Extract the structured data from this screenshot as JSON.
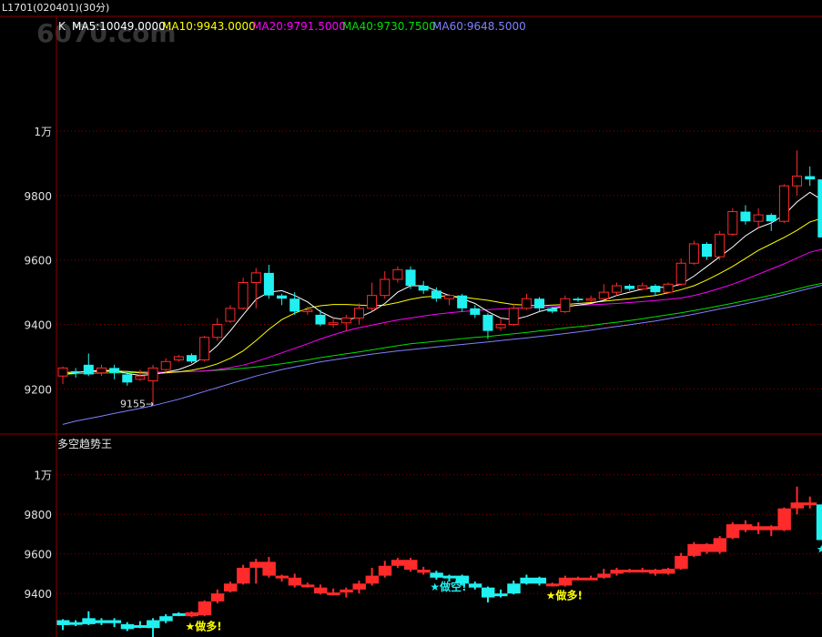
{
  "header": {
    "contract": "L1701(020401)(30分)",
    "watermark": "6070.com"
  },
  "colors": {
    "background": "#000000",
    "grid": "#8a0000",
    "axis_text": "#e0e0e0",
    "up": "#ff2a2a",
    "down": "#20f0f0",
    "ma5": "#ffffff",
    "ma10": "#ffff00",
    "ma20": "#ff00ff",
    "ma40": "#00e000",
    "ma60": "#8080ff"
  },
  "chart_data": [
    {
      "type": "candlestick",
      "legend": {
        "prefix": "K",
        "items": [
          {
            "label": "MA5:10049.0000",
            "color": "#ffffff"
          },
          {
            "label": "MA10:9943.0000",
            "color": "#ffff00"
          },
          {
            "label": "MA20:9791.5000",
            "color": "#ff00ff"
          },
          {
            "label": "MA40:9730.7500",
            "color": "#00e000"
          },
          {
            "label": "MA60:9648.5000",
            "color": "#8080ff"
          }
        ]
      },
      "ylim": [
        9060,
        10350
      ],
      "yticks": [
        {
          "value": 9200,
          "label": "9200"
        },
        {
          "value": 9400,
          "label": "9400"
        },
        {
          "value": 9600,
          "label": "9600"
        },
        {
          "value": 9800,
          "label": "9800"
        },
        {
          "value": 10000,
          "label": "1万"
        }
      ],
      "grid": true,
      "annotation": {
        "text": "9155",
        "value": 9155,
        "index": 7
      },
      "candles": [
        [
          9240,
          9265,
          9215,
          9270
        ],
        [
          9255,
          9250,
          9235,
          9265
        ],
        [
          9275,
          9245,
          9240,
          9310
        ],
        [
          9250,
          9265,
          9240,
          9275
        ],
        [
          9265,
          9250,
          9230,
          9275
        ],
        [
          9245,
          9220,
          9210,
          9255
        ],
        [
          9230,
          9240,
          9225,
          9260
        ],
        [
          9225,
          9265,
          9155,
          9275
        ],
        [
          9260,
          9285,
          9250,
          9295
        ],
        [
          9290,
          9300,
          9285,
          9305
        ],
        [
          9305,
          9285,
          9280,
          9310
        ],
        [
          9290,
          9360,
          9285,
          9365
        ],
        [
          9360,
          9400,
          9350,
          9420
        ],
        [
          9410,
          9450,
          9405,
          9460
        ],
        [
          9450,
          9530,
          9445,
          9545
        ],
        [
          9530,
          9560,
          9450,
          9575
        ],
        [
          9560,
          9490,
          9480,
          9585
        ],
        [
          9490,
          9480,
          9460,
          9495
        ],
        [
          9480,
          9440,
          9430,
          9500
        ],
        [
          9440,
          9445,
          9430,
          9455
        ],
        [
          9430,
          9400,
          9395,
          9445
        ],
        [
          9400,
          9405,
          9390,
          9425
        ],
        [
          9405,
          9420,
          9380,
          9430
        ],
        [
          9420,
          9450,
          9400,
          9465
        ],
        [
          9450,
          9490,
          9440,
          9530
        ],
        [
          9490,
          9540,
          9480,
          9565
        ],
        [
          9540,
          9570,
          9530,
          9580
        ],
        [
          9570,
          9520,
          9510,
          9580
        ],
        [
          9520,
          9505,
          9495,
          9535
        ],
        [
          9505,
          9480,
          9470,
          9515
        ],
        [
          9480,
          9490,
          9460,
          9495
        ],
        [
          9490,
          9450,
          9440,
          9495
        ],
        [
          9450,
          9430,
          9420,
          9460
        ],
        [
          9430,
          9380,
          9355,
          9435
        ],
        [
          9390,
          9400,
          9380,
          9420
        ],
        [
          9400,
          9450,
          9395,
          9465
        ],
        [
          9450,
          9480,
          9445,
          9495
        ],
        [
          9480,
          9450,
          9440,
          9485
        ],
        [
          9450,
          9440,
          9435,
          9455
        ],
        [
          9440,
          9480,
          9435,
          9490
        ],
        [
          9480,
          9475,
          9470,
          9485
        ],
        [
          9475,
          9480,
          9470,
          9490
        ],
        [
          9480,
          9500,
          9475,
          9525
        ],
        [
          9500,
          9520,
          9490,
          9530
        ],
        [
          9520,
          9510,
          9505,
          9525
        ],
        [
          9510,
          9520,
          9505,
          9530
        ],
        [
          9520,
          9500,
          9490,
          9525
        ],
        [
          9500,
          9525,
          9495,
          9530
        ],
        [
          9525,
          9590,
          9520,
          9605
        ],
        [
          9590,
          9650,
          9585,
          9660
        ],
        [
          9650,
          9610,
          9600,
          9655
        ],
        [
          9610,
          9680,
          9600,
          9690
        ],
        [
          9680,
          9750,
          9675,
          9760
        ],
        [
          9750,
          9720,
          9710,
          9770
        ],
        [
          9720,
          9740,
          9700,
          9760
        ],
        [
          9740,
          9720,
          9690,
          9745
        ],
        [
          9720,
          9830,
          9715,
          9835
        ],
        [
          9830,
          9860,
          9800,
          9940
        ],
        [
          9860,
          9850,
          9830,
          9890
        ],
        [
          9850,
          9670,
          9660,
          9860
        ],
        [
          9670,
          9650,
          9580,
          9680
        ],
        [
          9650,
          9700,
          9620,
          9730
        ]
      ],
      "ma": {
        "ma5": [
          9245,
          9250,
          9255,
          9258,
          9257,
          9248,
          9242,
          9245,
          9252,
          9260,
          9275,
          9300,
          9335,
          9380,
          9430,
          9478,
          9500,
          9505,
          9490,
          9470,
          9440,
          9420,
          9415,
          9422,
          9440,
          9465,
          9500,
          9520,
          9520,
          9505,
          9490,
          9480,
          9465,
          9440,
          9420,
          9415,
          9425,
          9440,
          9450,
          9455,
          9460,
          9465,
          9475,
          9490,
          9500,
          9510,
          9515,
          9515,
          9525,
          9550,
          9580,
          9610,
          9640,
          9675,
          9700,
          9715,
          9740,
          9780,
          9810,
          9785,
          9760,
          9720
        ],
        "ma10": [
          9250,
          9252,
          9254,
          9255,
          9256,
          9254,
          9250,
          9248,
          9250,
          9253,
          9258,
          9266,
          9278,
          9295,
          9318,
          9350,
          9385,
          9415,
          9435,
          9450,
          9458,
          9462,
          9462,
          9460,
          9458,
          9460,
          9468,
          9478,
          9485,
          9488,
          9488,
          9485,
          9480,
          9475,
          9468,
          9462,
          9460,
          9458,
          9460,
          9462,
          9465,
          9468,
          9472,
          9476,
          9480,
          9485,
          9490,
          9498,
          9508,
          9520,
          9538,
          9558,
          9580,
          9605,
          9630,
          9650,
          9670,
          9692,
          9718,
          9730,
          9738,
          9740
        ],
        "ma20": [
          9252,
          9252,
          9253,
          9253,
          9254,
          9254,
          9253,
          9252,
          9252,
          9253,
          9254,
          9256,
          9260,
          9266,
          9274,
          9285,
          9298,
          9312,
          9326,
          9340,
          9355,
          9368,
          9380,
          9390,
          9398,
          9406,
          9414,
          9420,
          9426,
          9432,
          9436,
          9440,
          9443,
          9446,
          9448,
          9450,
          9452,
          9454,
          9455,
          9457,
          9459,
          9461,
          9463,
          9465,
          9468,
          9471,
          9474,
          9478,
          9482,
          9490,
          9500,
          9512,
          9525,
          9540,
          9556,
          9572,
          9588,
          9606,
          9624,
          9634,
          9640,
          9645
        ],
        "ma40": [
          9245,
          9247,
          9248,
          9249,
          9250,
          9250,
          9251,
          9251,
          9252,
          9253,
          9254,
          9256,
          9258,
          9261,
          9264,
          9268,
          9273,
          9278,
          9284,
          9290,
          9297,
          9303,
          9309,
          9315,
          9321,
          9328,
          9334,
          9340,
          9344,
          9348,
          9352,
          9356,
          9360,
          9363,
          9367,
          9371,
          9375,
          9380,
          9384,
          9389,
          9393,
          9397,
          9402,
          9407,
          9412,
          9418,
          9424,
          9430,
          9436,
          9443,
          9450,
          9458,
          9466,
          9474,
          9482,
          9491,
          9500,
          9510,
          9520,
          9528,
          9536,
          9544
        ],
        "ma60": [
          9090,
          9100,
          9108,
          9116,
          9124,
          9132,
          9140,
          9148,
          9158,
          9168,
          9180,
          9192,
          9204,
          9216,
          9228,
          9240,
          9250,
          9260,
          9268,
          9276,
          9284,
          9290,
          9296,
          9302,
          9308,
          9313,
          9318,
          9322,
          9326,
          9330,
          9334,
          9338,
          9342,
          9346,
          9350,
          9354,
          9358,
          9363,
          9367,
          9372,
          9377,
          9382,
          9388,
          9394,
          9399,
          9405,
          9411,
          9418,
          9425,
          9432,
          9440,
          9448,
          9456,
          9464,
          9473,
          9482,
          9492,
          9502,
          9512,
          9522,
          9532,
          9542
        ]
      }
    },
    {
      "type": "bar",
      "title": "多空趋势王",
      "ylim": [
        9180,
        10100
      ],
      "yticks": [
        {
          "value": 9400,
          "label": "9400"
        },
        {
          "value": 9600,
          "label": "9600"
        },
        {
          "value": 9800,
          "label": "9800"
        },
        {
          "value": 10000,
          "label": "1万"
        }
      ],
      "grid": true,
      "signals": [
        {
          "index": 10,
          "text": "做多!",
          "color": "#ffff00",
          "star_color": "#ffff00"
        },
        {
          "index": 29,
          "text": "做空!",
          "color": "#20f0f0",
          "star_color": "#20f0f0"
        },
        {
          "index": 38,
          "text": "做多!",
          "color": "#ffff00",
          "star_color": "#ffff00"
        },
        {
          "index": 59,
          "text": "做空!",
          "color": "#20f0f0",
          "star_color": "#20f0f0"
        }
      ]
    }
  ]
}
